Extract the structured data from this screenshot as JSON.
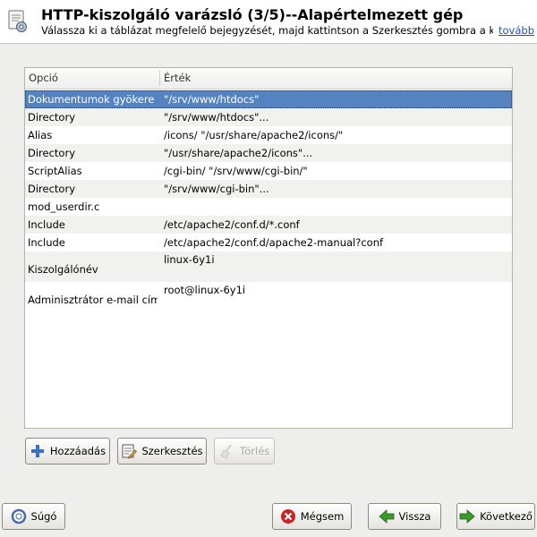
{
  "header": {
    "title": "HTTP-kiszolgáló varázsló (3/5)--Alapértelmezett gép",
    "subtitle": "Válassza ki a táblázat megfelelő bejegyzését, majd kattintson a Szerkesztés gombra a kisz...",
    "more_link": "tovább",
    "icon": "server-config-icon"
  },
  "table": {
    "columns": [
      "Opció",
      "Érték"
    ],
    "rows": [
      {
        "option": "Dokumentumok gyökere",
        "value": "\"/srv/www/htdocs\"",
        "selected": true
      },
      {
        "option": "Directory",
        "value": "\"/srv/www/htdocs\"..."
      },
      {
        "option": "Alias",
        "value": "/icons/ \"/usr/share/apache2/icons/\""
      },
      {
        "option": "Directory",
        "value": "\"/usr/share/apache2/icons\"..."
      },
      {
        "option": "ScriptAlias",
        "value": "/cgi-bin/ \"/srv/www/cgi-bin/\""
      },
      {
        "option": "Directory",
        "value": "\"/srv/www/cgi-bin\"..."
      },
      {
        "option": "mod_userdir.c",
        "value": ""
      },
      {
        "option": "Include",
        "value": "/etc/apache2/conf.d/*.conf"
      },
      {
        "option": "Include",
        "value": "/etc/apache2/conf.d/apache2-manual?conf"
      },
      {
        "option": "Kiszolgálónév",
        "value": "linux-6y1i"
      },
      {
        "option": "Adminisztrátor e-mail címe",
        "value": "root@linux-6y1i"
      }
    ]
  },
  "table_actions": {
    "add_label": "Hozzáadás",
    "edit_label": "Szerkesztés",
    "delete_label": "Törlés"
  },
  "footer": {
    "help_label": "Súgó",
    "cancel_label": "Mégsem",
    "back_label": "Vissza",
    "next_label": "Következő"
  },
  "colors": {
    "selection": "#5583c1",
    "link": "#2850a8",
    "cancel_icon": "#cc2222",
    "nav_arrow": "#3a9a2a",
    "add_icon": "#3a6fc4"
  }
}
